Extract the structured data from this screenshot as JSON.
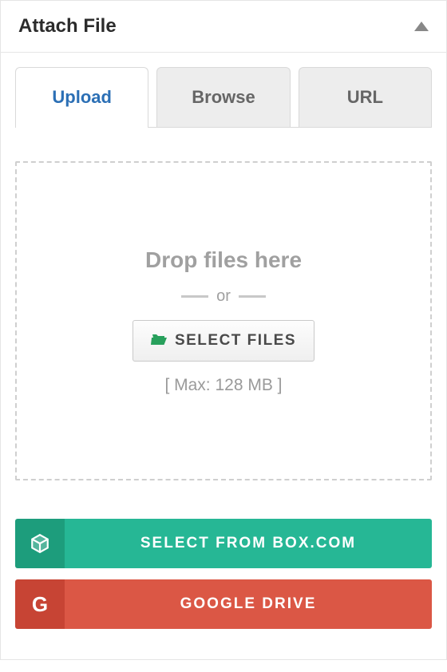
{
  "header": {
    "title": "Attach File"
  },
  "tabs": {
    "upload": "Upload",
    "browse": "Browse",
    "url": "URL"
  },
  "dropzone": {
    "drop_text": "Drop files here",
    "or_text": "or",
    "select_label": "SELECT FILES",
    "max_text": "[ Max: 128 MB ]"
  },
  "providers": {
    "box_label": "SELECT FROM BOX.COM",
    "gdrive_label": "GOOGLE DRIVE",
    "gdrive_letter": "G"
  }
}
